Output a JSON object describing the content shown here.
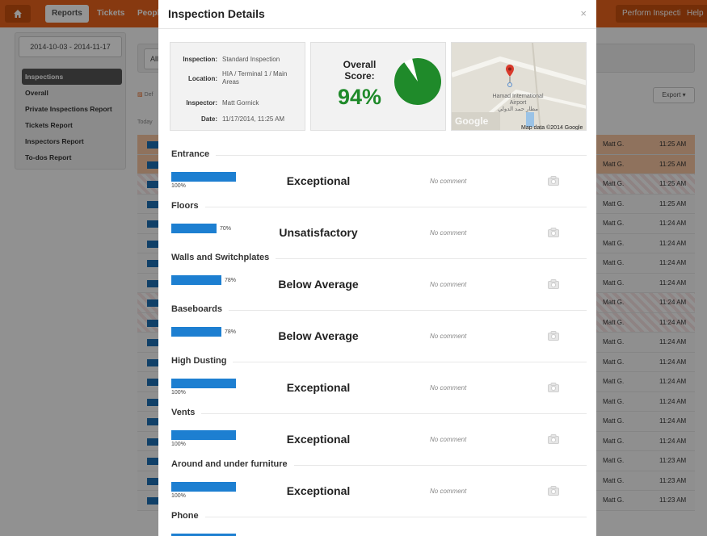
{
  "nav": {
    "reports": "Reports",
    "tickets": "Tickets",
    "people": "People",
    "perform": "Perform Inspection",
    "help": "Help"
  },
  "sidebar": {
    "date_range": "2014-10-03 - 2014-11-17",
    "items": [
      "Inspections",
      "Overall",
      "Private Inspections Report",
      "Tickets Report",
      "Inspectors Report",
      "To-dos Report"
    ]
  },
  "background": {
    "all_label": "All",
    "export_label": "Export",
    "def_label": "Def",
    "today_label": "Today",
    "rows": [
      {
        "who": "Matt G.",
        "time": "11:25 AM",
        "style": "flag"
      },
      {
        "who": "Matt G.",
        "time": "11:25 AM",
        "style": "flag"
      },
      {
        "who": "Matt G.",
        "time": "11:25 AM",
        "style": "stripe"
      },
      {
        "who": "Matt G.",
        "time": "11:25 AM",
        "style": ""
      },
      {
        "who": "Matt G.",
        "time": "11:24 AM",
        "style": ""
      },
      {
        "who": "Matt G.",
        "time": "11:24 AM",
        "style": ""
      },
      {
        "who": "Matt G.",
        "time": "11:24 AM",
        "style": ""
      },
      {
        "who": "Matt G.",
        "time": "11:24 AM",
        "style": ""
      },
      {
        "who": "Matt G.",
        "time": "11:24 AM",
        "style": "stripe"
      },
      {
        "who": "Matt G.",
        "time": "11:24 AM",
        "style": "stripe"
      },
      {
        "who": "Matt G.",
        "time": "11:24 AM",
        "style": ""
      },
      {
        "who": "Matt G.",
        "time": "11:24 AM",
        "style": ""
      },
      {
        "who": "Matt G.",
        "time": "11:24 AM",
        "style": ""
      },
      {
        "who": "Matt G.",
        "time": "11:24 AM",
        "style": ""
      },
      {
        "who": "Matt G.",
        "time": "11:24 AM",
        "style": ""
      },
      {
        "who": "Matt G.",
        "time": "11:24 AM",
        "style": ""
      },
      {
        "who": "Matt G.",
        "time": "11:23 AM",
        "style": ""
      },
      {
        "who": "Matt G.",
        "time": "11:23 AM",
        "style": ""
      },
      {
        "who": "Matt G.",
        "time": "11:23 AM",
        "style": ""
      }
    ]
  },
  "modal": {
    "title": "Inspection Details",
    "close": "×",
    "info": {
      "inspection_label": "Inspection:",
      "inspection": "Standard Inspection",
      "location_label": "Location:",
      "location": "HIA / Terminal 1 / Main Areas",
      "inspector_label": "Inspector:",
      "inspector": "Matt Gornick",
      "date_label": "Date:",
      "date": "11/17/2014, 11:25 AM"
    },
    "score": {
      "label": "Overall Score:",
      "value": "94%",
      "fraction": 0.94,
      "color": "#1f8a2a"
    },
    "map": {
      "place": "Hamad International Airport",
      "place_ar": "مطار حمد الدولي",
      "logo": "Google",
      "credit": "Map data ©2014 Google"
    },
    "sections": [
      {
        "name": "Entrance",
        "percent_text": "100%",
        "value": 1.0,
        "rating": "Exceptional",
        "comment": "No comment"
      },
      {
        "name": "Floors",
        "percent_text": "70%",
        "value": 0.7,
        "rating": "Unsatisfactory",
        "comment": "No comment"
      },
      {
        "name": "Walls and Switchplates",
        "percent_text": "78%",
        "value": 0.78,
        "rating": "Below Average",
        "comment": "No comment"
      },
      {
        "name": "Baseboards",
        "percent_text": "78%",
        "value": 0.78,
        "rating": "Below Average",
        "comment": "No comment"
      },
      {
        "name": "High Dusting",
        "percent_text": "100%",
        "value": 1.0,
        "rating": "Exceptional",
        "comment": "No comment"
      },
      {
        "name": "Vents",
        "percent_text": "100%",
        "value": 1.0,
        "rating": "Exceptional",
        "comment": "No comment"
      },
      {
        "name": "Around and under furniture",
        "percent_text": "100%",
        "value": 1.0,
        "rating": "Exceptional",
        "comment": "No comment"
      },
      {
        "name": "Phone",
        "percent_text": "",
        "value": 1.0,
        "rating": "",
        "comment": ""
      }
    ]
  }
}
